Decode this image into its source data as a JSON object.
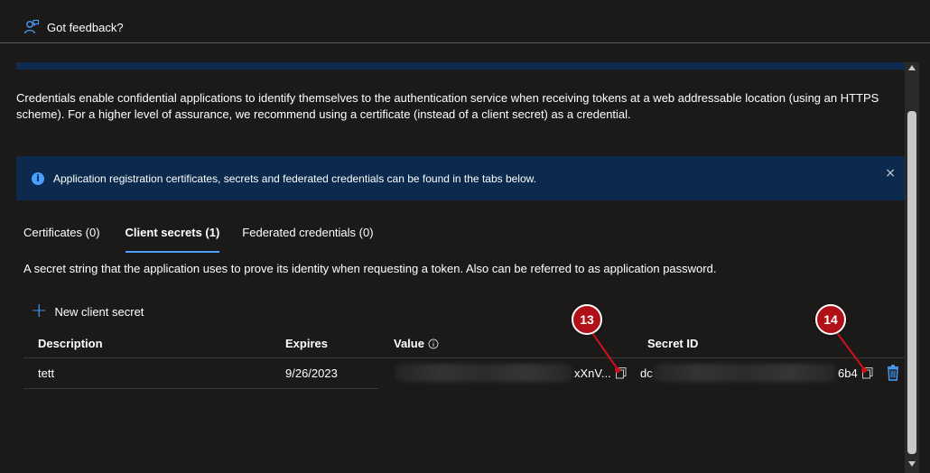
{
  "toolbar": {
    "feedback_label": "Got feedback?"
  },
  "description": "Credentials enable confidential applications to identify themselves to the authentication service when receiving tokens at a web addressable location (using an HTTPS scheme). For a higher level of assurance, we recommend using a certificate (instead of a client secret) as a credential.",
  "banner": {
    "text": "Application registration certificates, secrets and federated credentials can be found in the tabs below.",
    "close": "×"
  },
  "tabs": [
    {
      "label": "Certificates (0)"
    },
    {
      "label": "Client secrets (1)"
    },
    {
      "label": "Federated credentials (0)"
    }
  ],
  "secret_description": "A secret string that the application uses to prove its identity when requesting a token. Also can be referred to as application password.",
  "new_secret_label": "New client secret",
  "table": {
    "headers": {
      "description": "Description",
      "expires": "Expires",
      "value": "Value",
      "secret_id": "Secret ID"
    },
    "row": {
      "description": "tett",
      "expires": "9/26/2023",
      "value_visible": "xXnV...",
      "secret_id_prefix": "dc",
      "secret_id_suffix": "6b4"
    }
  },
  "annotations": {
    "badge_value": "13",
    "badge_secret_id": "14"
  },
  "icons": {
    "feedback": "feedback-person-icon",
    "info": "info-icon",
    "close": "close-icon",
    "plus": "plus-icon",
    "copy": "copy-icon",
    "delete": "trash-icon"
  },
  "colors": {
    "accent": "#4aa0ff",
    "banner_bg": "#0c2a4d",
    "badge": "#b01018"
  }
}
